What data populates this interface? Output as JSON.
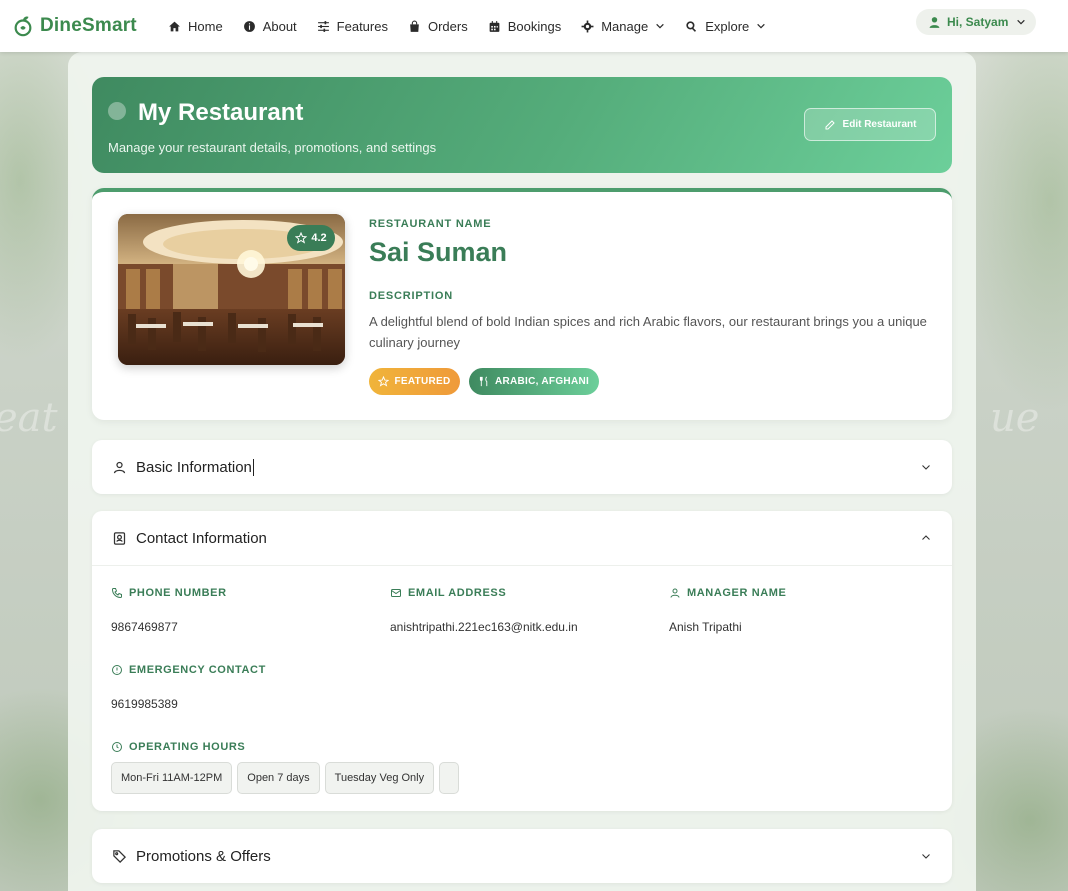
{
  "nav": {
    "brand": "DineSmart",
    "items": [
      {
        "label": "Home",
        "icon": "home-icon"
      },
      {
        "label": "About",
        "icon": "info-icon"
      },
      {
        "label": "Features",
        "icon": "sliders-icon"
      },
      {
        "label": "Orders",
        "icon": "shopping-bag-icon"
      },
      {
        "label": "Bookings",
        "icon": "calendar-icon"
      },
      {
        "label": "Manage",
        "icon": "gear-icon"
      },
      {
        "label": "Explore",
        "icon": "search-icon"
      }
    ],
    "user_greeting": "Hi, Satyam"
  },
  "hero": {
    "title": "My Restaurant",
    "subtitle": "Manage your restaurant details, promotions, and settings",
    "edit_label": "Edit Restaurant"
  },
  "restaurant": {
    "rating": "4.2",
    "name_label": "RESTAURANT NAME",
    "name": "Sai Suman",
    "description_label": "DESCRIPTION",
    "description": "A delightful blend of bold Indian spices and rich Arabic flavors, our restaurant brings you a unique culinary journey",
    "tags": {
      "featured": "FEATURED",
      "cuisine": "ARABIC, AFGHANI"
    }
  },
  "sections": {
    "basic": "Basic Information",
    "contact": "Contact Information",
    "promotions": "Promotions & Offers"
  },
  "contact": {
    "phone_label": "PHONE NUMBER",
    "phone": "9867469877",
    "email_label": "EMAIL ADDRESS",
    "email": "anishtripathi.221ec163@nitk.edu.in",
    "manager_label": "MANAGER NAME",
    "manager": "Anish Tripathi",
    "emergency_label": "EMERGENCY CONTACT",
    "emergency": "9619985389",
    "hours_label": "OPERATING HOURS",
    "hours": [
      "Mon-Fri 11AM-12PM",
      "Open 7 days",
      "Tuesday Veg Only",
      ""
    ]
  },
  "colors": {
    "brand": "#3c8a4e",
    "accent": "#3a7d57",
    "featured": "#f0b43a"
  }
}
